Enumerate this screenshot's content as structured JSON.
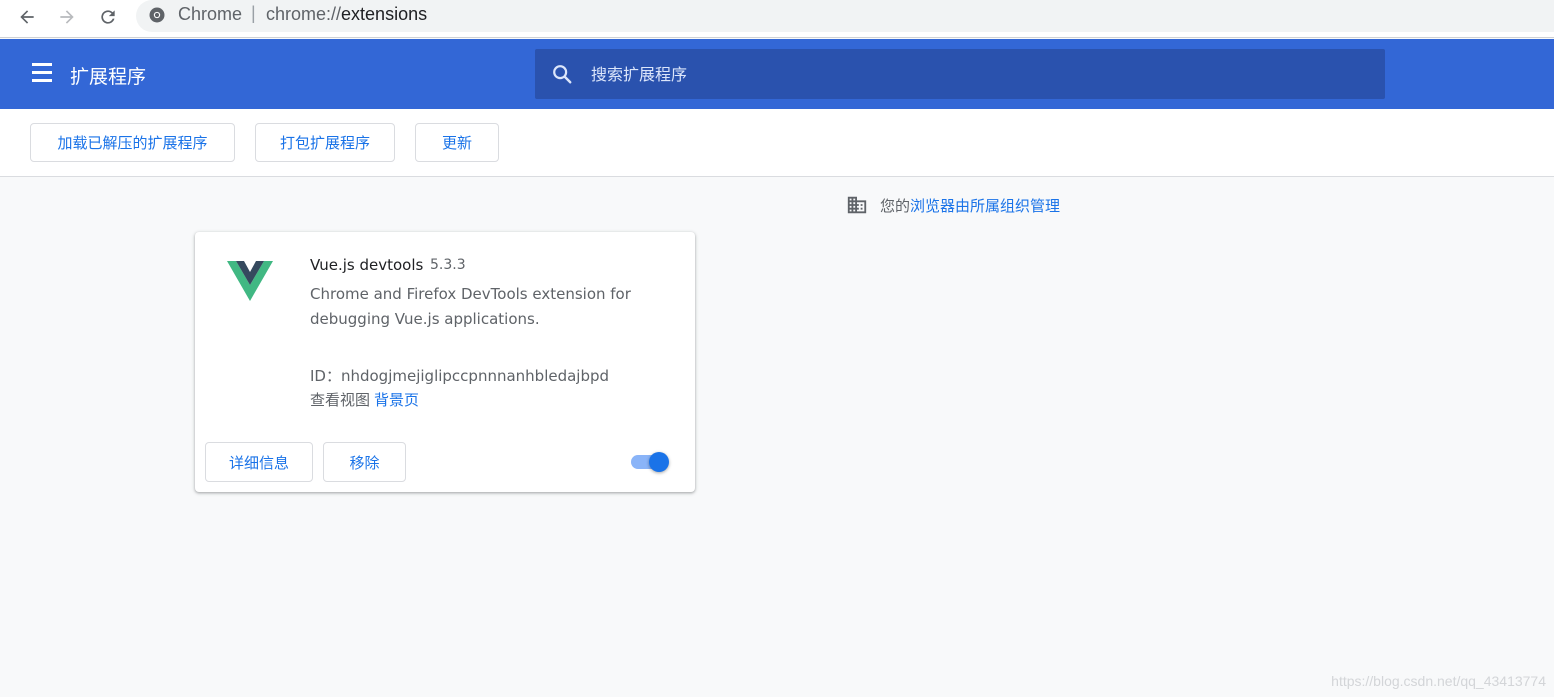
{
  "browser": {
    "scheme_label": "Chrome",
    "separator": "|",
    "url_prefix": "chrome://",
    "url_host": "extensions"
  },
  "toolbar": {
    "title": "扩展程序",
    "search_placeholder": "搜索扩展程序",
    "background_color": "#3367d6"
  },
  "actions": {
    "load_unpacked": "加载已解压的扩展程序",
    "pack": "打包扩展程序",
    "update": "更新"
  },
  "managed_notice": {
    "prefix": "您的",
    "link": "浏览器由所属组织管理"
  },
  "extension": {
    "name": "Vue.js devtools",
    "version": "5.3.3",
    "description": "Chrome and Firefox DevTools extension for debugging Vue.js applications.",
    "id_label": "ID：nhdogjmejiglipccpnnnanhbledajbpd",
    "views_label": "查看视图",
    "views_link": "背景页",
    "details_button": "详细信息",
    "remove_button": "移除",
    "enabled": true
  },
  "watermark": "https://blog.csdn.net/qq_43413774",
  "colors": {
    "accent": "#1a73e8",
    "vue_green": "#41b883",
    "vue_dark": "#35495e"
  }
}
